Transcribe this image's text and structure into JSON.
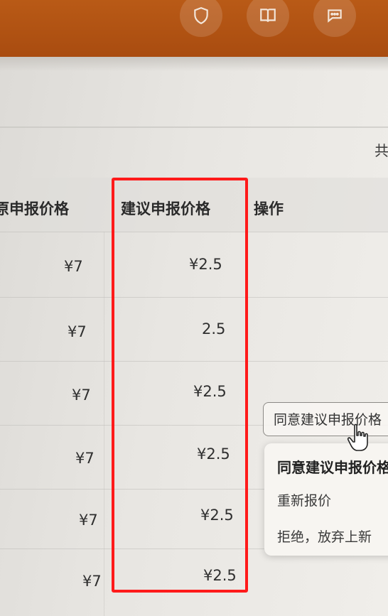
{
  "topbar": {
    "icons": [
      "shield-icon",
      "book-icon",
      "chat-icon"
    ],
    "color": "#b35414"
  },
  "summary": {
    "total_label": "共"
  },
  "table": {
    "headers": {
      "original_price": "原申报价格",
      "suggested_price": "建议申报价格",
      "action": "操作"
    },
    "rows": [
      {
        "original_price": "¥7",
        "suggested_price": "¥2.5"
      },
      {
        "original_price": "¥7",
        "suggested_price": "2.5"
      },
      {
        "original_price": "¥7",
        "suggested_price": "¥2.5"
      },
      {
        "original_price": "¥7",
        "suggested_price": "¥2.5"
      },
      {
        "original_price": "¥7",
        "suggested_price": "¥2.5"
      },
      {
        "original_price": "¥7",
        "suggested_price": "¥2.5"
      }
    ]
  },
  "action": {
    "agree_button_label": "同意建议申报价格",
    "menu": [
      "同意建议申报价格",
      "重新报价",
      "拒绝，放弃上新"
    ]
  },
  "highlight_color": "#ff1a1a"
}
